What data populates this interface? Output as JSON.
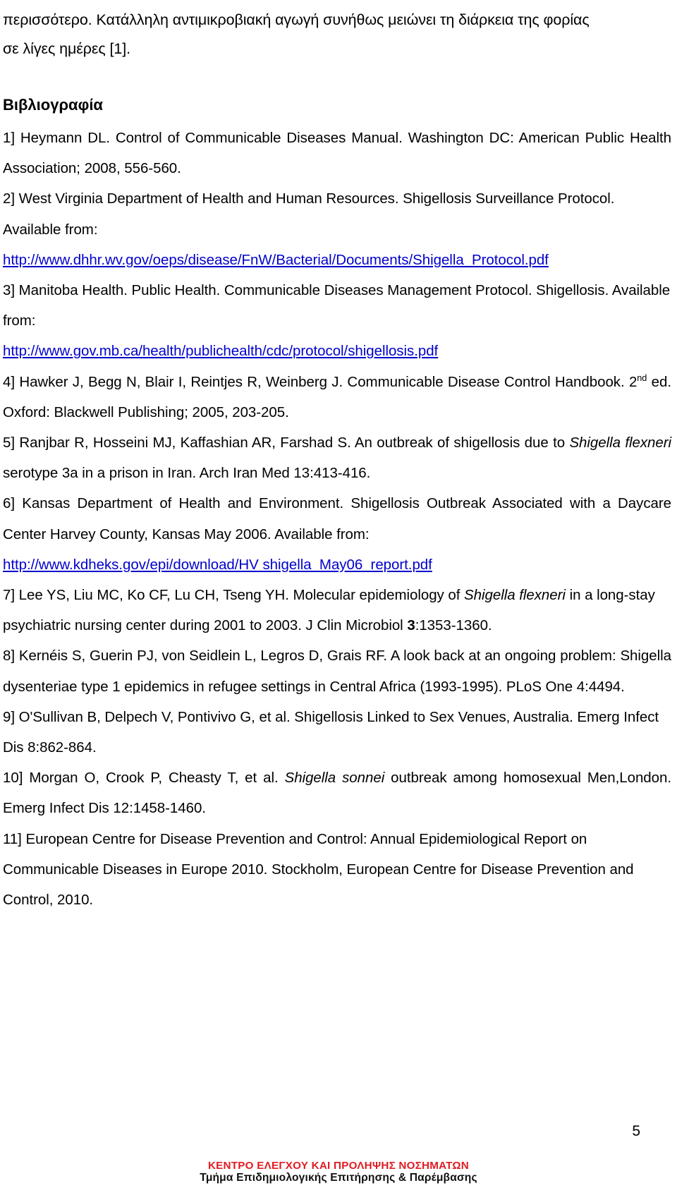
{
  "document": {
    "intro_paragraph": {
      "line1": "περισσότερο. Κατάλληλη αντιμικροβιακή αγωγή συνήθως μειώνει τη διάρκεια της φορίας",
      "line2": "σε λίγες ημέρες [1]."
    },
    "bibliography_heading": "Βιβλιογραφία",
    "references": [
      {
        "marker": "1]",
        "text_before": "Heymann DL. Control of Communicable Diseases Manual. Washington DC: American Public Health Association; 2008, 556-560."
      },
      {
        "marker": "2]",
        "text_before": "West Virginia Department of Health and Human Resources. Shigellosis Surveillance Protocol.",
        "available_label": "Available from:",
        "url": "http://www.dhhr.wv.gov/oeps/disease/FnW/Bacterial/Documents/Shigella_Protocol.pdf"
      },
      {
        "marker": "3]",
        "text_before": "Manitoba Health. Public Health. Communicable Diseases Management Protocol. Shigellosis. Available from:",
        "url": "http://www.gov.mb.ca/health/publichealth/cdc/protocol/shigellosis.pdf"
      },
      {
        "marker": "4]",
        "text_part1": "Hawker J, Begg N, Blair I, Reintjes R, Weinberg J. Communicable Disease Control Handbook. 2",
        "ordinal": "nd",
        "text_part2": " ed. Oxford: Blackwell Publishing; 2005, 203-205."
      },
      {
        "marker": "5]",
        "text_part1": "Ranjbar R, Hosseini MJ, Kaffashian AR, Farshad S. An outbreak of shigellosis due to ",
        "italic": "Shigella flexneri",
        "text_part2": " serotype 3a in a prison in Iran. Arch Iran Med 13:413-416."
      },
      {
        "marker": "6]",
        "text_before": "Kansas Department of Health and Environment. Shigellosis Outbreak Associated with a Daycare Center Harvey County, Kansas May 2006. Available from:",
        "url": "http://www.kdheks.gov/epi/download/HV shigella_May06_report.pdf"
      },
      {
        "marker": "7]",
        "text_part1": "Lee YS, Liu MC, Ko CF, Lu CH, Tseng YH. Molecular epidemiology of ",
        "italic": "Shigella flexneri",
        "text_part2": " in a long-stay psychiatric nursing center during 2001 to 2003. J Clin Microbiol ",
        "bold": "3",
        "text_part3": ":1353-1360."
      },
      {
        "marker": "8]",
        "text_before": "Kernéis S, Guerin PJ, von Seidlein L, Legros D, Grais RF.  A look back at an ongoing problem: Shigella dysenteriae type 1 epidemics in refugee settings in Central Africa (1993-1995).  PLoS One 4:4494."
      },
      {
        "marker": "9]",
        "text_before": "O'Sullivan B, Delpech V, Pontivivo G, et al. Shigellosis Linked to Sex Venues, Australia. Emerg Infect Dis 8:862-864."
      },
      {
        "marker": "10]",
        "text_part1": "Morgan O, Crook P, Cheasty T, et al. ",
        "italic": "Shigella sonnei",
        "text_part2": " outbreak among homosexual Men,London. Emerg Infect  Dis 12:1458-1460."
      },
      {
        "marker": "11]",
        "text_before": "European Centre for Disease Prevention and Control: Annual Epidemiological Report on Communicable Diseases in Europe 2010. Stockholm, European Centre for Disease Prevention and Control, 2010."
      }
    ],
    "page_number": "5",
    "footer": {
      "organization": "ΚΕΝΤΡΟ ΕΛΕΓΧΟΥ ΚΑΙ ΠΡΟΛΗΨΗΣ ΝΟΣΗΜΑΤΩΝ",
      "department": "Τμήμα Επιδημιολογικής Επιτήρησης & Παρέμβασης"
    },
    "colors": {
      "link": "#0000cd",
      "footer_title": "#e01b22",
      "text": "#000000"
    }
  }
}
